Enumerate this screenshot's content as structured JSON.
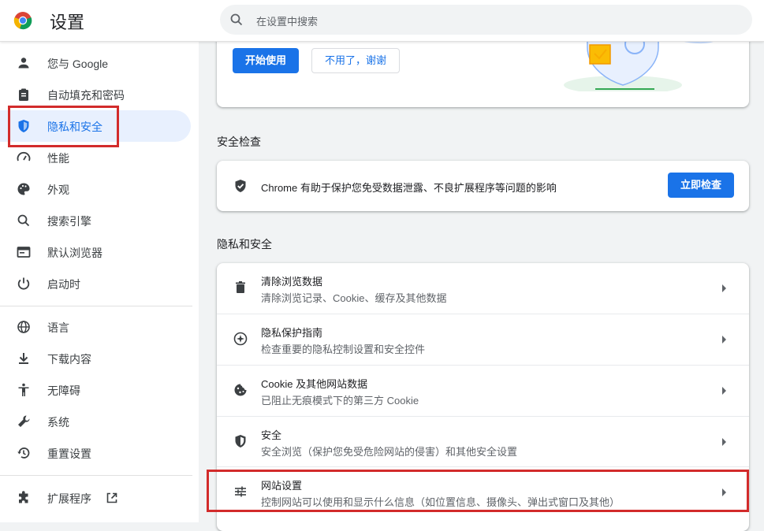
{
  "header": {
    "title": "设置",
    "search_placeholder": "在设置中搜索"
  },
  "sidebar": {
    "items": [
      {
        "label": "您与 Google",
        "icon": "person-icon"
      },
      {
        "label": "自动填充和密码",
        "icon": "clipboard-icon"
      },
      {
        "label": "隐私和安全",
        "icon": "shield-icon",
        "active": true
      },
      {
        "label": "性能",
        "icon": "speedometer-icon"
      },
      {
        "label": "外观",
        "icon": "palette-icon"
      },
      {
        "label": "搜索引擎",
        "icon": "search-icon"
      },
      {
        "label": "默认浏览器",
        "icon": "browser-window-icon"
      },
      {
        "label": "启动时",
        "icon": "power-icon"
      },
      {
        "label": "语言",
        "icon": "globe-icon"
      },
      {
        "label": "下载内容",
        "icon": "download-icon"
      },
      {
        "label": "无障碍",
        "icon": "accessibility-icon"
      },
      {
        "label": "系统",
        "icon": "wrench-icon"
      },
      {
        "label": "重置设置",
        "icon": "reset-history-icon"
      },
      {
        "label": "扩展程序",
        "icon": "puzzle-icon"
      }
    ]
  },
  "promo": {
    "start_label": "开始使用",
    "dismiss_label": "不用了，谢谢"
  },
  "safety_check": {
    "section_title": "安全检查",
    "description": "Chrome 有助于保护您免受数据泄露、不良扩展程序等问题的影响",
    "button_label": "立即检查"
  },
  "privacy": {
    "section_title": "隐私和安全",
    "rows": [
      {
        "title": "清除浏览数据",
        "subtitle": "清除浏览记录、Cookie、缓存及其他数据",
        "icon": "trash-icon"
      },
      {
        "title": "隐私保护指南",
        "subtitle": "检查重要的隐私控制设置和安全控件",
        "icon": "compass-icon"
      },
      {
        "title": "Cookie 及其他网站数据",
        "subtitle": "已阻止无痕模式下的第三方 Cookie",
        "icon": "cookie-icon"
      },
      {
        "title": "安全",
        "subtitle": "安全浏览（保护您免受危险网站的侵害）和其他安全设置",
        "icon": "shield-icon"
      },
      {
        "title": "网站设置",
        "subtitle": "控制网站可以使用和显示什么信息（如位置信息、摄像头、弹出式窗口及其他）",
        "icon": "sliders-icon"
      }
    ]
  },
  "colors": {
    "accent": "#1a73e8",
    "highlight": "#d22b2b",
    "active_bg": "#e8f0fe"
  }
}
